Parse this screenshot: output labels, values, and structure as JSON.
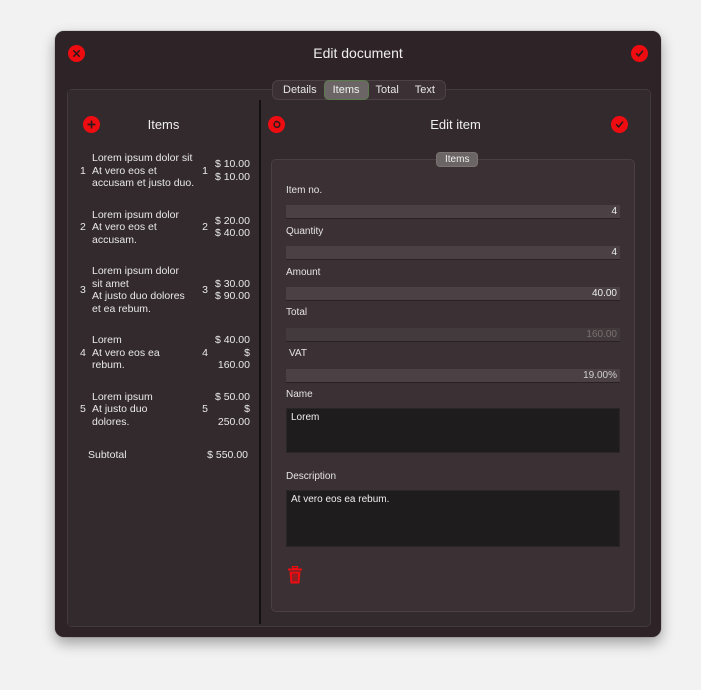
{
  "window": {
    "title": "Edit document",
    "cancel_icon": "x-circle-icon",
    "confirm_icon": "checkmark-circle-icon"
  },
  "tabs": [
    {
      "label": "Details",
      "active": false
    },
    {
      "label": "Items",
      "active": true
    },
    {
      "label": "Total",
      "active": false
    },
    {
      "label": "Text",
      "active": false
    }
  ],
  "items_pane": {
    "title": "Items",
    "add_icon": "plus-circle-icon",
    "items": [
      {
        "no": "1",
        "lines": [
          "Lorem ipsum dolor sit",
          "At vero eos et",
          "accusam et justo duo."
        ],
        "qty": "1",
        "amount": "$ 10.00",
        "total": "$ 10.00"
      },
      {
        "no": "2",
        "lines": [
          "Lorem ipsum dolor",
          "At vero eos et",
          "accusam."
        ],
        "qty": "2",
        "amount": "$ 20.00",
        "total": "$ 40.00"
      },
      {
        "no": "3",
        "lines": [
          "Lorem ipsum dolor",
          "sit amet",
          "At justo duo dolores",
          "et ea rebum."
        ],
        "qty": "3",
        "amount": "$ 30.00",
        "total": "$ 90.00"
      },
      {
        "no": "4",
        "lines": [
          "Lorem",
          "At vero eos ea",
          "rebum."
        ],
        "qty": "4",
        "amount": "$ 40.00",
        "total": "$ 160.00"
      },
      {
        "no": "5",
        "lines": [
          "Lorem ipsum",
          "At justo duo",
          "dolores."
        ],
        "qty": "5",
        "amount": "$ 50.00",
        "total": "$ 250.00"
      }
    ],
    "subtotal_label": "Subtotal",
    "subtotal_value": "$ 550.00"
  },
  "edit_pane": {
    "title": "Edit item",
    "revert_icon": "revert-circle-icon",
    "confirm_icon": "checkmark-circle-icon",
    "group_label": "Items",
    "fields": {
      "item_no": {
        "label": "Item no.",
        "value": "4"
      },
      "quantity": {
        "label": "Quantity",
        "value": "4"
      },
      "amount": {
        "label": "Amount",
        "value": "40.00"
      },
      "total": {
        "label": "Total",
        "value": "160.00"
      },
      "vat": {
        "label": "VAT",
        "value": "19.00%"
      },
      "name": {
        "label": "Name",
        "value": "Lorem"
      },
      "description": {
        "label": "Description",
        "value": "At vero eos ea rebum."
      }
    },
    "delete_icon": "trash-icon"
  },
  "colors": {
    "accent": "#ee0c10",
    "window_bg": "#2e2326"
  }
}
